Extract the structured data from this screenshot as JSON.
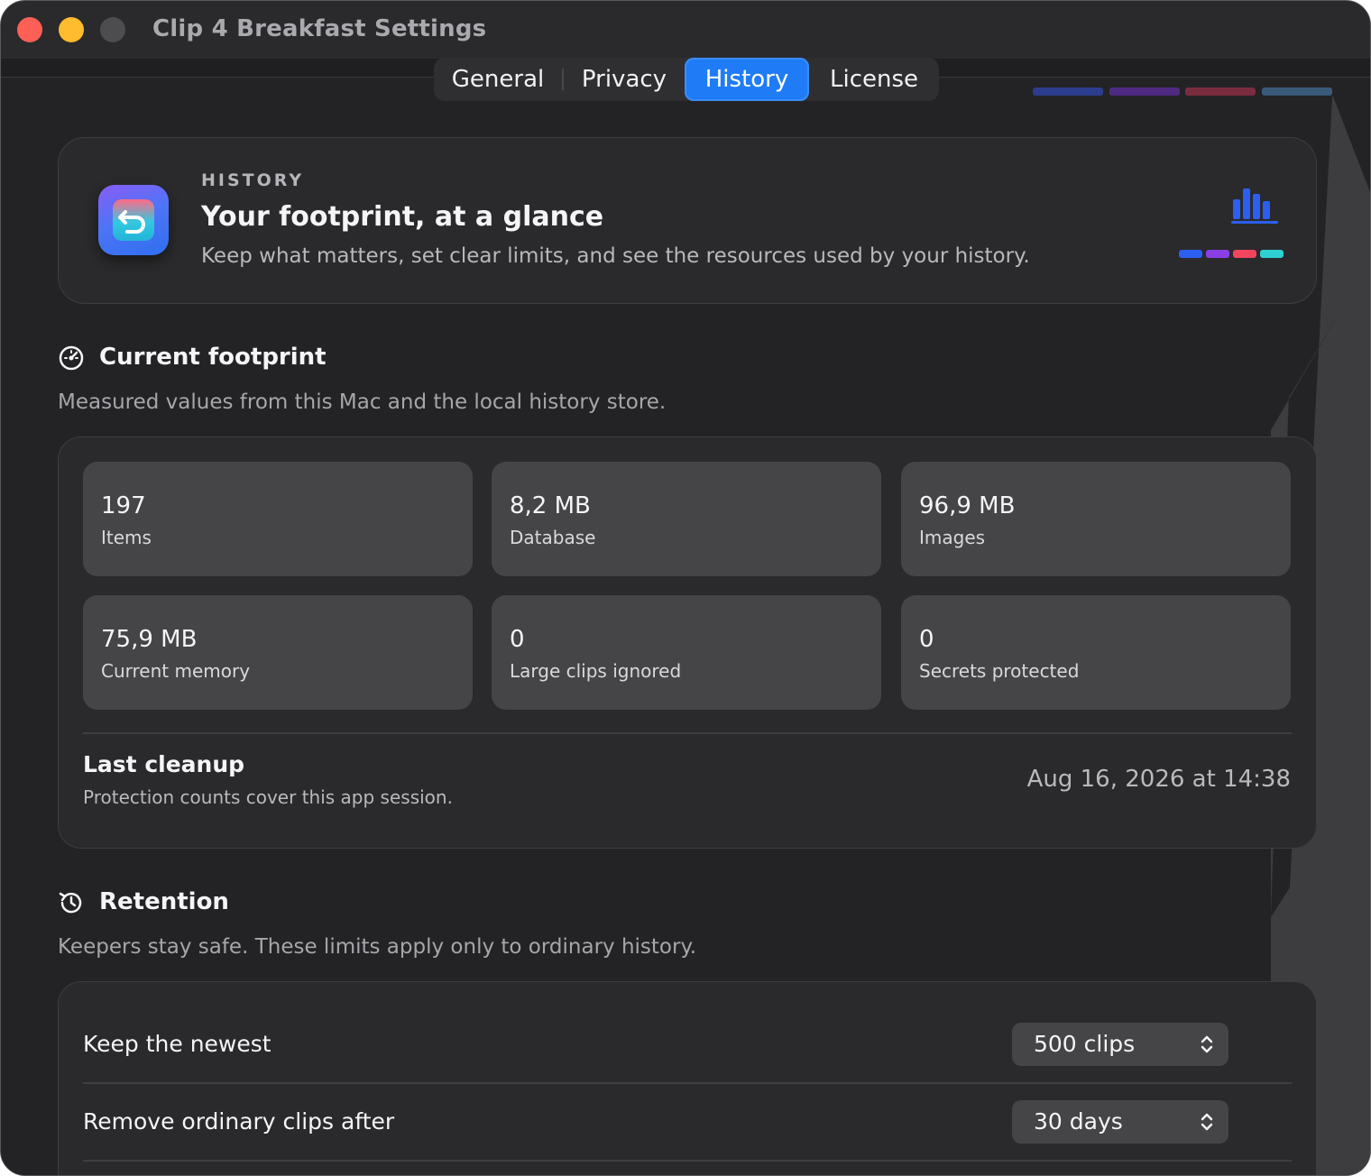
{
  "window": {
    "title": "Clip 4 Breakfast Settings"
  },
  "tabs": [
    {
      "label": "General",
      "selected": false
    },
    {
      "label": "Privacy",
      "selected": false
    },
    {
      "label": "History",
      "selected": true
    },
    {
      "label": "License",
      "selected": false
    }
  ],
  "colors": {
    "accent": "#1f7cf6",
    "bar_blue": "#2c5ff1",
    "bar_purple": "#8a3fe6",
    "bar_red": "#f2455d",
    "bar_teal": "#2fd0d3"
  },
  "hero": {
    "kicker": "HISTORY",
    "title": "Your footprint, at a glance",
    "subtitle": "Keep what matters, set clear limits, and see the resources used by your history.",
    "icon": "app-icon",
    "chart_icon": "bar-chart-icon"
  },
  "footprint": {
    "title": "Current footprint",
    "icon": "gauge-icon",
    "subtitle": "Measured values from this Mac and the local history store.",
    "stats": [
      {
        "value": "197",
        "label": "Items"
      },
      {
        "value": "8,2 MB",
        "label": "Database"
      },
      {
        "value": "96,9 MB",
        "label": "Images"
      },
      {
        "value": "75,9 MB",
        "label": "Current memory"
      },
      {
        "value": "0",
        "label": "Large clips ignored"
      },
      {
        "value": "0",
        "label": "Secrets protected"
      }
    ],
    "last_cleanup": {
      "title": "Last cleanup",
      "subtitle": "Protection counts cover this app session.",
      "date": "Aug 16, 2026 at 14:38"
    }
  },
  "retention": {
    "title": "Retention",
    "icon": "history-clock-icon",
    "subtitle": "Keepers stay safe. These limits apply only to ordinary history.",
    "rows": [
      {
        "label": "Keep the newest",
        "value": "500 clips"
      },
      {
        "label": "Remove ordinary clips after",
        "value": "30 days"
      }
    ]
  }
}
